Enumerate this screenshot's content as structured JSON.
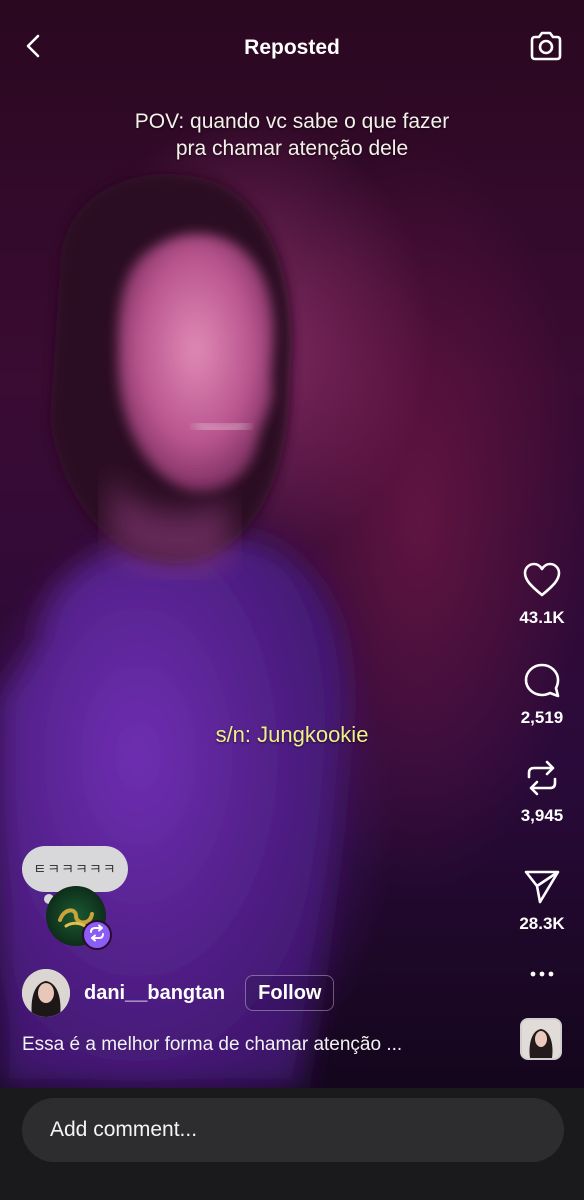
{
  "header": {
    "title": "Reposted",
    "back_icon": "chevron-left-icon",
    "camera_icon": "camera-icon"
  },
  "video": {
    "caption_lines": [
      "POV: quando vc sabe o que fazer",
      "pra chamar atenção dele"
    ],
    "subtitle": "s/n: Jungkookie"
  },
  "actions": {
    "like": {
      "icon": "heart-icon",
      "count": "43.1K"
    },
    "comment": {
      "icon": "comment-bubble-icon",
      "count": "2,519"
    },
    "repost": {
      "icon": "repost-icon",
      "count": "3,945"
    },
    "share": {
      "icon": "send-icon",
      "count": "28.3K"
    },
    "more": {
      "icon": "more-dots-icon"
    }
  },
  "repost": {
    "bubble_text": "ㅌㅋㅋㅋㅋㅋ",
    "badge_icon": "repost-badge-icon"
  },
  "author": {
    "username": "dani__bangtan",
    "follow_label": "Follow"
  },
  "description": "Essa é a melhor forma de chamar atenção ...",
  "comment_input": {
    "placeholder": "Add comment..."
  },
  "colors": {
    "subtitle": "#eef08a",
    "repost_badge": "#8b5cf6",
    "bottom_bar": "#1a1a1c",
    "comment_field": "#2d2d30"
  }
}
